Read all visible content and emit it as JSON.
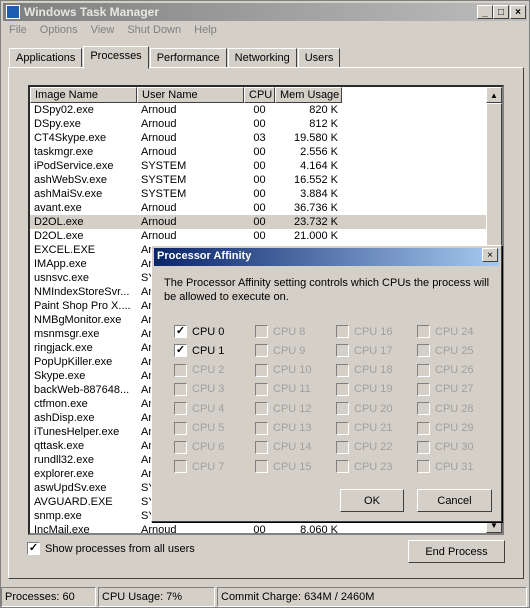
{
  "window": {
    "title": "Windows Task Manager"
  },
  "menu": [
    "File",
    "Options",
    "View",
    "Shut Down",
    "Help"
  ],
  "tabs": [
    "Applications",
    "Processes",
    "Performance",
    "Networking",
    "Users"
  ],
  "columns": [
    "Image Name",
    "User Name",
    "CPU",
    "Mem Usage"
  ],
  "processes": [
    [
      "DSpy02.exe",
      "Arnoud",
      "00",
      "820 K"
    ],
    [
      "DSpy.exe",
      "Arnoud",
      "00",
      "812 K"
    ],
    [
      "CT4Skype.exe",
      "Arnoud",
      "03",
      "19.580 K"
    ],
    [
      "taskmgr.exe",
      "Arnoud",
      "00",
      "2.556 K"
    ],
    [
      "iPodService.exe",
      "SYSTEM",
      "00",
      "4.164 K"
    ],
    [
      "ashWebSv.exe",
      "SYSTEM",
      "00",
      "16.552 K"
    ],
    [
      "ashMaiSv.exe",
      "SYSTEM",
      "00",
      "3.884 K"
    ],
    [
      "avant.exe",
      "Arnoud",
      "00",
      "36.736 K"
    ],
    [
      "D2OL.exe",
      "Arnoud",
      "00",
      "23.732 K"
    ],
    [
      "D2OL.exe",
      "Arnoud",
      "00",
      "21.000 K"
    ],
    [
      "EXCEL.EXE",
      "Ar",
      "",
      ""
    ],
    [
      "IMApp.exe",
      "Ar",
      "",
      ""
    ],
    [
      "usnsvc.exe",
      "SY",
      "",
      ""
    ],
    [
      "NMIndexStoreSvr...",
      "Ar",
      "",
      ""
    ],
    [
      "Paint Shop Pro X....",
      "Ar",
      "",
      ""
    ],
    [
      "NMBgMonitor.exe",
      "Ar",
      "",
      ""
    ],
    [
      "msnmsgr.exe",
      "Ar",
      "",
      ""
    ],
    [
      "ringjack.exe",
      "Ar",
      "",
      ""
    ],
    [
      "PopUpKiller.exe",
      "Ar",
      "",
      ""
    ],
    [
      "Skype.exe",
      "Ar",
      "",
      ""
    ],
    [
      "backWeb-887648...",
      "Ar",
      "",
      ""
    ],
    [
      "ctfmon.exe",
      "Ar",
      "",
      ""
    ],
    [
      "ashDisp.exe",
      "Ar",
      "",
      ""
    ],
    [
      "iTunesHelper.exe",
      "Ar",
      "",
      ""
    ],
    [
      "qttask.exe",
      "Ar",
      "",
      ""
    ],
    [
      "rundll32.exe",
      "Ar",
      "",
      ""
    ],
    [
      "explorer.exe",
      "Ar",
      "",
      ""
    ],
    [
      "aswUpdSv.exe",
      "SY",
      "",
      ""
    ],
    [
      "AVGUARD.EXE",
      "SY",
      "",
      ""
    ],
    [
      "snmp.exe",
      "SY",
      "",
      ""
    ],
    [
      "IncMail.exe",
      "Arnoud",
      "00",
      "8.060 K"
    ]
  ],
  "selected_row": 8,
  "show_all_users": {
    "label": "Show processes from all users",
    "checked": true
  },
  "end_process": "End Process",
  "status": {
    "processes": "Processes: 60",
    "cpu": "CPU Usage: 7%",
    "commit": "Commit Charge: 634M / 2460M"
  },
  "dialog": {
    "title": "Processor Affinity",
    "text": "The Processor Affinity setting controls which CPUs the process will be allowed to execute on.",
    "cpus": [
      {
        "label": "CPU 0",
        "checked": true,
        "enabled": true
      },
      {
        "label": "CPU 1",
        "checked": true,
        "enabled": true
      },
      {
        "label": "CPU 2",
        "checked": false,
        "enabled": false
      },
      {
        "label": "CPU 3",
        "checked": false,
        "enabled": false
      },
      {
        "label": "CPU 4",
        "checked": false,
        "enabled": false
      },
      {
        "label": "CPU 5",
        "checked": false,
        "enabled": false
      },
      {
        "label": "CPU 6",
        "checked": false,
        "enabled": false
      },
      {
        "label": "CPU 7",
        "checked": false,
        "enabled": false
      },
      {
        "label": "CPU 8",
        "checked": false,
        "enabled": false
      },
      {
        "label": "CPU 9",
        "checked": false,
        "enabled": false
      },
      {
        "label": "CPU 10",
        "checked": false,
        "enabled": false
      },
      {
        "label": "CPU 11",
        "checked": false,
        "enabled": false
      },
      {
        "label": "CPU 12",
        "checked": false,
        "enabled": false
      },
      {
        "label": "CPU 13",
        "checked": false,
        "enabled": false
      },
      {
        "label": "CPU 14",
        "checked": false,
        "enabled": false
      },
      {
        "label": "CPU 15",
        "checked": false,
        "enabled": false
      },
      {
        "label": "CPU 16",
        "checked": false,
        "enabled": false
      },
      {
        "label": "CPU 17",
        "checked": false,
        "enabled": false
      },
      {
        "label": "CPU 18",
        "checked": false,
        "enabled": false
      },
      {
        "label": "CPU 19",
        "checked": false,
        "enabled": false
      },
      {
        "label": "CPU 20",
        "checked": false,
        "enabled": false
      },
      {
        "label": "CPU 21",
        "checked": false,
        "enabled": false
      },
      {
        "label": "CPU 22",
        "checked": false,
        "enabled": false
      },
      {
        "label": "CPU 23",
        "checked": false,
        "enabled": false
      },
      {
        "label": "CPU 24",
        "checked": false,
        "enabled": false
      },
      {
        "label": "CPU 25",
        "checked": false,
        "enabled": false
      },
      {
        "label": "CPU 26",
        "checked": false,
        "enabled": false
      },
      {
        "label": "CPU 27",
        "checked": false,
        "enabled": false
      },
      {
        "label": "CPU 28",
        "checked": false,
        "enabled": false
      },
      {
        "label": "CPU 29",
        "checked": false,
        "enabled": false
      },
      {
        "label": "CPU 30",
        "checked": false,
        "enabled": false
      },
      {
        "label": "CPU 31",
        "checked": false,
        "enabled": false
      }
    ],
    "ok": "OK",
    "cancel": "Cancel"
  }
}
